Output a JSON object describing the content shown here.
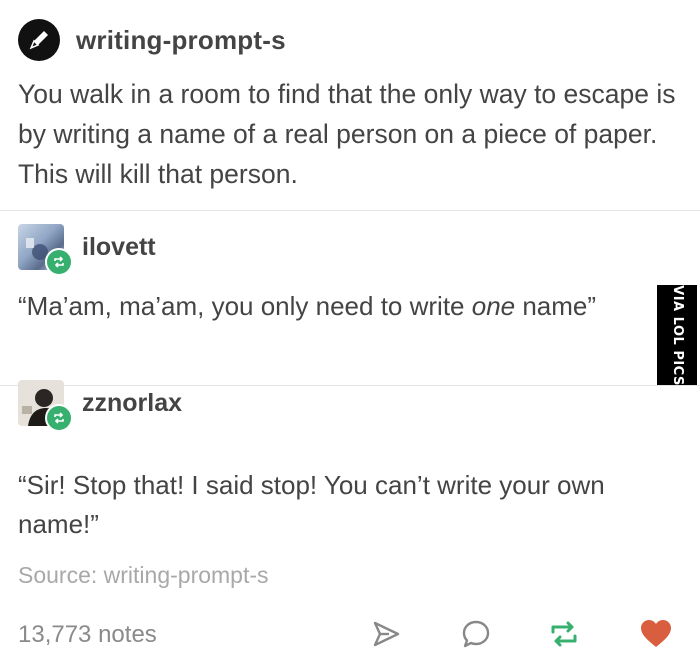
{
  "post": {
    "author": "writing-prompt-s",
    "body": "You walk in a room to find that the only way to escape is by writing a name of a real person on a piece of paper. This will kill that person."
  },
  "reblogs": [
    {
      "author": "ilovett",
      "body_before": "“Ma’am, ma’am, you only need to write ",
      "body_emphasis": "one",
      "body_after": " name”"
    },
    {
      "author": "zznorlax",
      "body": "“Sir! Stop that! I said stop! You can’t write your own name!”"
    }
  ],
  "source": "Source: writing-prompt-s",
  "footer": {
    "notes": "13,773 notes",
    "icons": [
      "share-icon",
      "reply-icon",
      "reblog-icon",
      "like-icon"
    ]
  },
  "watermark": "VIA LOL PICS",
  "colors": {
    "text": "#444444",
    "muted": "#a8a8a8",
    "reblog_badge": "#37b06f",
    "like": "#d95e40"
  }
}
